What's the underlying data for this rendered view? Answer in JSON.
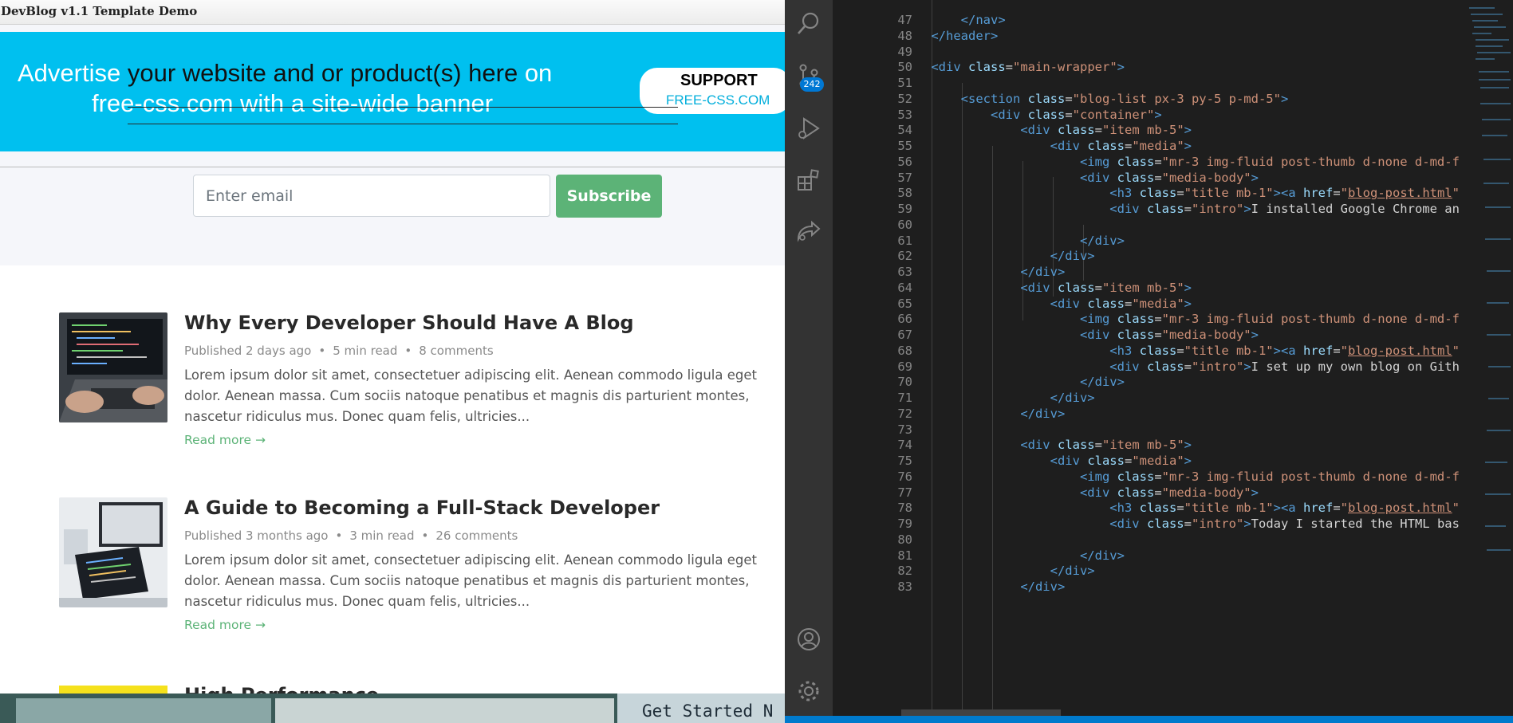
{
  "browser": {
    "page_title": "DevBlog v1.1 Template Demo",
    "banner": {
      "line1_a": "Advertise ",
      "line1_b": "your website and or product(s) here ",
      "line1_c": "on",
      "line2": "free-css.com with a site-wide banner",
      "support_title": "SUPPORT",
      "support_site": "FREE-CSS.COM",
      "bg_color": "#00c0ef"
    },
    "subscribe": {
      "email_placeholder": "Enter email",
      "button_label": "Subscribe",
      "button_color": "#5cb377"
    },
    "posts": [
      {
        "title": "Why Every Developer Should Have A Blog",
        "published": "Published 2 days ago",
        "read_time": "5 min read",
        "comments": "8 comments",
        "intro": "Lorem ipsum dolor sit amet, consectetuer adipiscing elit. Aenean commodo ligula eget dolor. Aenean massa. Cum sociis natoque penatibus et magnis dis parturient montes, nascetur ridiculus mus. Donec quam felis, ultricies...",
        "read_more": "Read more →"
      },
      {
        "title": "A Guide to Becoming a Full-Stack Developer",
        "published": "Published 3 months ago",
        "read_time": "3 min read",
        "comments": "26 comments",
        "intro": "Lorem ipsum dolor sit amet, consectetuer adipiscing elit. Aenean commodo ligula eget dolor. Aenean massa. Cum sociis natoque penatibus et magnis dis parturient montes, nascetur ridiculus mus. Donec quam felis, ultricies...",
        "read_more": "Read more →"
      }
    ],
    "partial_post_title": "High Performance JavaScript"
  },
  "taskbar": {
    "text": "Get Started N"
  },
  "vscode": {
    "scm_badge": "242",
    "line_numbers": [
      "47",
      "48",
      "49",
      "50",
      "51",
      "52",
      "53",
      "54",
      "55",
      "56",
      "57",
      "58",
      "59",
      "60",
      "61",
      "62",
      "63",
      "64",
      "65",
      "66",
      "67",
      "68",
      "69",
      "70",
      "71",
      "72",
      "73",
      "74",
      "75",
      "76",
      "77",
      "78",
      "79",
      "80",
      "81",
      "82",
      "83"
    ],
    "accent_color": "#007acc"
  }
}
